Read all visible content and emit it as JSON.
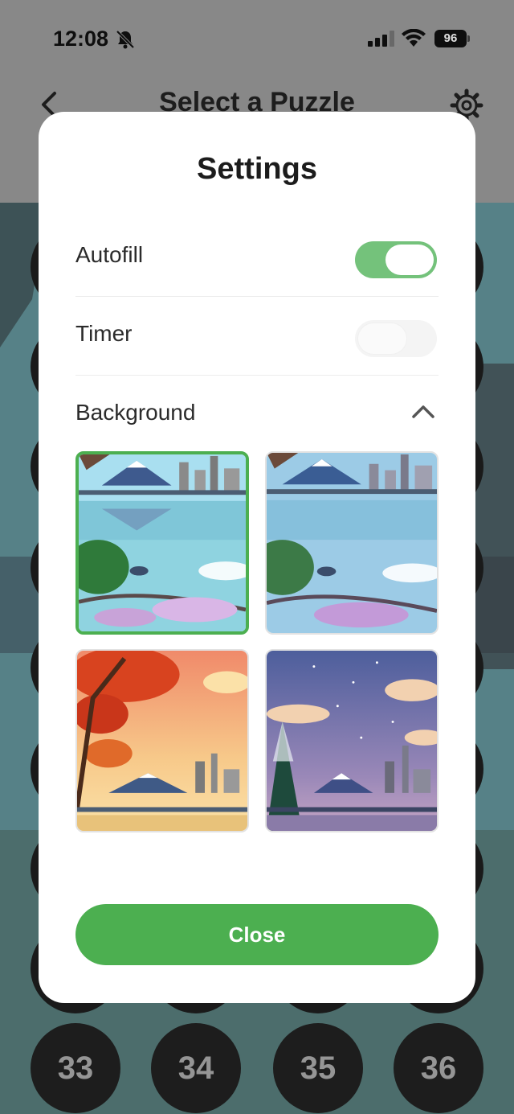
{
  "status_bar": {
    "time": "12:08",
    "battery": "96",
    "icons": [
      "bell-slash-icon",
      "signal-icon",
      "wifi-icon",
      "battery-icon"
    ]
  },
  "nav": {
    "back_icon": "chevron-left-icon",
    "title": "Select a Puzzle",
    "settings_icon": "gear-icon"
  },
  "puzzles": {
    "visible_numbers": [
      "33",
      "34",
      "35",
      "36"
    ]
  },
  "modal": {
    "title": "Settings",
    "autofill": {
      "label": "Autofill",
      "state": "on"
    },
    "timer": {
      "label": "Timer",
      "state": "off"
    },
    "background": {
      "label": "Background",
      "expanded": true,
      "toggle_icon": "chevron-up-icon"
    },
    "backgrounds": [
      {
        "theme": "spring-day",
        "selected": true
      },
      {
        "theme": "spring-dusk",
        "selected": false
      },
      {
        "theme": "autumn-sunset",
        "selected": false
      },
      {
        "theme": "winter-night",
        "selected": false
      }
    ],
    "close_label": "Close"
  },
  "colors": {
    "accent": "#4caf50",
    "toggle_on": "#74c27b",
    "modal_bg": "#ffffff",
    "title_text": "#1c1c1c"
  }
}
